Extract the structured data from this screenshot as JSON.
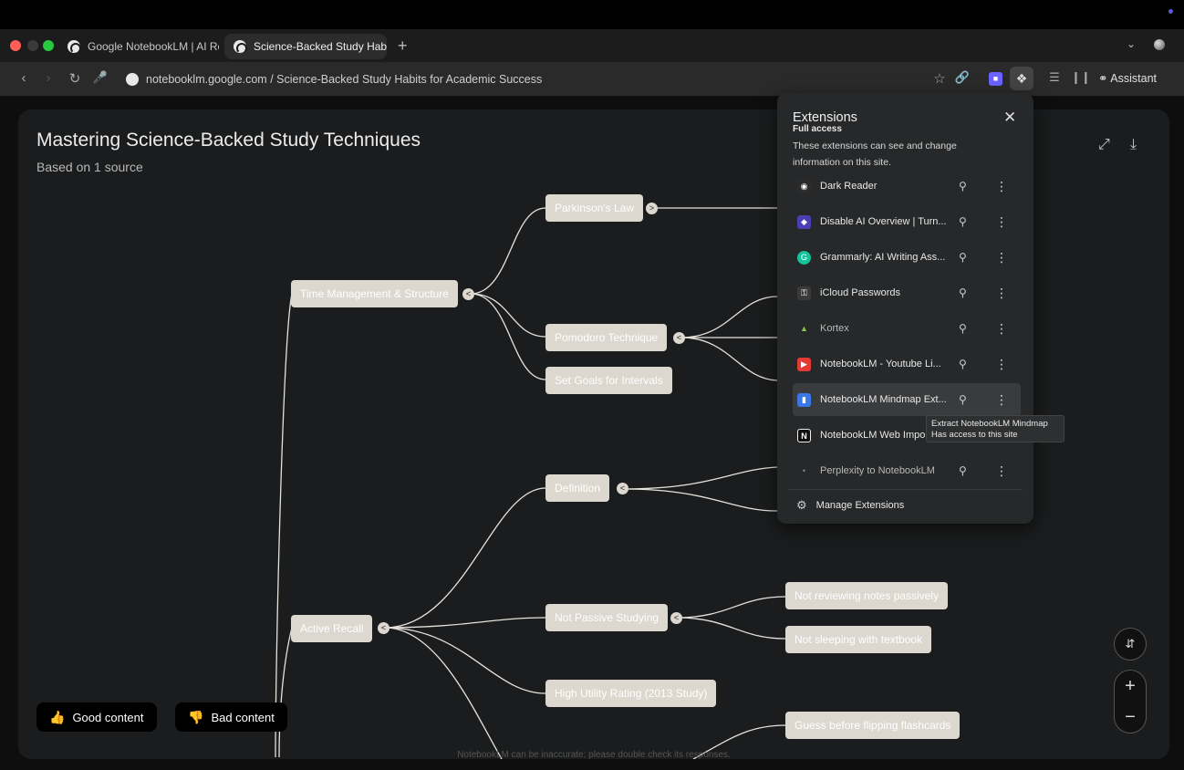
{
  "browser": {
    "tabs": [
      {
        "title": "Google NotebookLM | AI Re",
        "active": false
      },
      {
        "title": "Science-Backed Study Habi",
        "active": true
      }
    ],
    "url": "notebooklm.google.com / Science-Backed Study Habits for Academic Success",
    "assistant_label": "Assistant",
    "new_tab_symbol": "+"
  },
  "mindmap": {
    "title": "Mastering Science-Backed Study Techniques",
    "subtitle": "Based on 1 source",
    "nodes": {
      "time_management": "Time Management & Structure",
      "parkinsons_law": "Parkinson's Law",
      "pomodoro": "Pomodoro Technique",
      "set_goals": "Set Goals for Intervals",
      "active_recall": "Active Recall",
      "definition": "Definition",
      "not_passive": "Not Passive Studying",
      "not_reviewing": "Not reviewing notes passively",
      "not_sleeping": "Not sleeping with textbook",
      "high_utility": "High Utility Rating (2013 Study)",
      "guess_before": "Guess before flipping flashcards"
    },
    "feedback": {
      "good": "Good content",
      "bad": "Bad content"
    },
    "disclaimer": "NotebookLM can be inaccurate; please double check its responses."
  },
  "extensions": {
    "title": "Extensions",
    "section_heading": "Full access",
    "description": "These extensions can see and change information on this site.",
    "items": [
      {
        "name": "Dark Reader",
        "icon": "dark-reader-icon",
        "color": "#2b2b2b"
      },
      {
        "name": "Disable AI Overview | Turn...",
        "icon": "disable-ai-icon",
        "color": "#4a3fb5"
      },
      {
        "name": "Grammarly: AI Writing Ass...",
        "icon": "grammarly-icon",
        "color": "#15c39a"
      },
      {
        "name": "iCloud Passwords",
        "icon": "key-icon",
        "color": "#3a3a3a"
      },
      {
        "name": "Kortex",
        "icon": "kortex-icon",
        "color": "#8bc34a"
      },
      {
        "name": "NotebookLM - Youtube Li...",
        "icon": "youtube-icon",
        "color": "#e53935"
      },
      {
        "name": "NotebookLM Mindmap Ext...",
        "icon": "mindmap-ext-icon",
        "color": "#3b78e7"
      },
      {
        "name": "NotebookLM Web Impo",
        "icon": "notion-icon",
        "color": "#111111"
      },
      {
        "name": "Perplexity to NotebookLM",
        "icon": "perplexity-icon",
        "color": "#3a3a3a"
      }
    ],
    "manage_label": "Manage Extensions",
    "tooltip": {
      "line1": "Extract NotebookLM Mindmap",
      "line2": "Has access to this site"
    }
  }
}
